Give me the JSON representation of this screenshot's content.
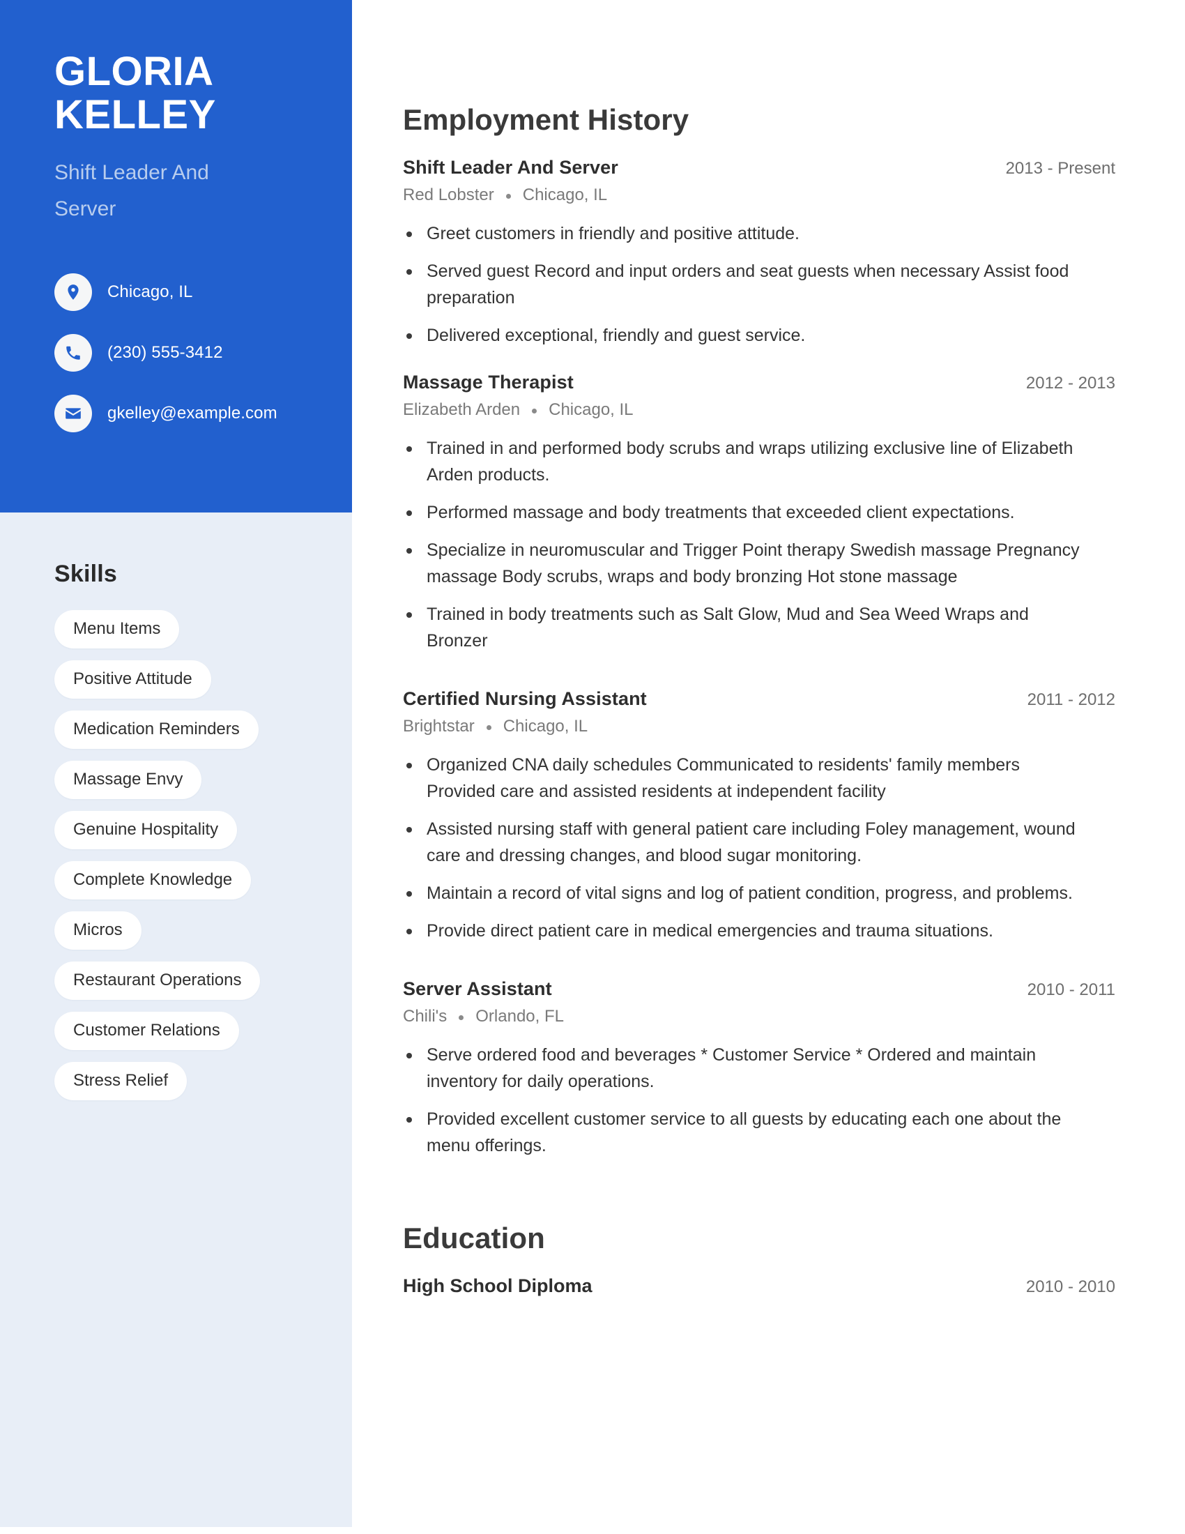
{
  "theme": {
    "primary": "#2260CE",
    "sidebar_bg": "#E8EEF7",
    "subtitle": "#B8CDEE",
    "body_text": "#333333",
    "muted_text": "#7A7A7A",
    "pill_bg": "#FFFFFF"
  },
  "header": {
    "first_name": "GLORIA",
    "last_name": "KELLEY",
    "job_title": "Shift Leader And Server"
  },
  "contact": [
    {
      "icon": "location-pin-icon",
      "label": "Chicago, IL"
    },
    {
      "icon": "phone-icon",
      "label": "(230) 555-3412"
    },
    {
      "icon": "envelope-icon",
      "label": "gkelley@example.com"
    }
  ],
  "skills": {
    "heading": "Skills",
    "items": [
      "Menu Items",
      "Positive Attitude",
      "Medication Reminders",
      "Massage Envy",
      "Genuine Hospitality",
      "Complete Knowledge",
      "Micros",
      "Restaurant Operations",
      "Customer Relations",
      "Stress Relief"
    ]
  },
  "employment": {
    "heading": "Employment History",
    "jobs": [
      {
        "role": "Shift Leader And Server",
        "dates": "2013 - Present",
        "company": "Red Lobster",
        "location": "Chicago, IL",
        "bullets": [
          "Greet customers in friendly and positive attitude.",
          "Served guest Record and input orders and seat guests when necessary Assist food preparation",
          "Delivered exceptional, friendly and guest service."
        ]
      },
      {
        "role": "Massage Therapist",
        "dates": "2012 - 2013",
        "company": "Elizabeth Arden",
        "location": "Chicago, IL",
        "bullets": [
          "Trained in and performed body scrubs and wraps utilizing exclusive line of Elizabeth Arden products.",
          "Performed massage and body treatments that exceeded client expectations.",
          "Specialize in neuromuscular and Trigger Point therapy Swedish massage Pregnancy massage Body scrubs, wraps and body bronzing Hot stone massage",
          "Trained in body treatments such as Salt Glow, Mud and Sea Weed Wraps and Bronzer"
        ]
      },
      {
        "role": "Certified Nursing Assistant",
        "dates": "2011 - 2012",
        "company": "Brightstar",
        "location": "Chicago, IL",
        "bullets": [
          "Organized CNA daily schedules Communicated to residents' family members Provided care and assisted residents at independent facility",
          "Assisted nursing staff with general patient care including Foley management, wound care and dressing changes, and blood sugar monitoring.",
          "Maintain a record of vital signs and log of patient condition, progress, and problems.",
          "Provide direct patient care in medical emergencies and trauma situations."
        ]
      },
      {
        "role": "Server Assistant",
        "dates": "2010 - 2011",
        "company": "Chili's",
        "location": "Orlando, FL",
        "bullets": [
          "Serve ordered food and beverages * Customer Service * Ordered and maintain inventory for daily operations.",
          "Provided excellent customer service to all guests by educating each one about the menu offerings."
        ]
      }
    ]
  },
  "education": {
    "heading": "Education",
    "entries": [
      {
        "degree": "High School Diploma",
        "dates": "2010 - 2010"
      }
    ]
  }
}
